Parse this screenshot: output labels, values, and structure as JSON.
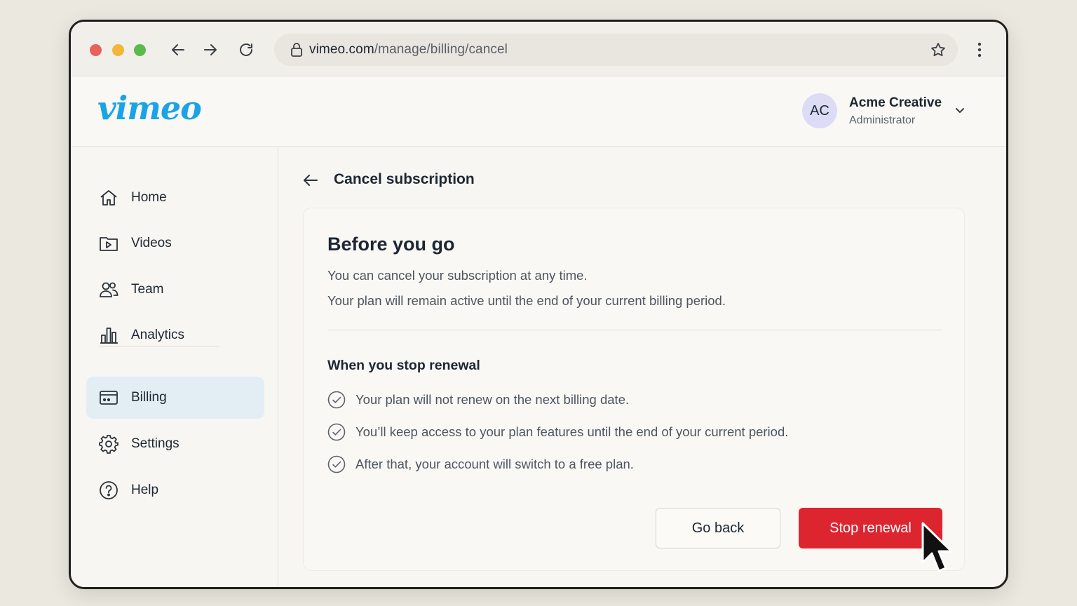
{
  "browser": {
    "url_host": "vimeo.com",
    "url_path": "/manage/billing/cancel"
  },
  "header": {
    "logo": "vimeo",
    "account": {
      "initials": "AC",
      "name": "Acme Creative",
      "role": "Administrator"
    }
  },
  "sidebar": {
    "items": [
      {
        "label": "Home",
        "icon": "home-icon"
      },
      {
        "label": "Videos",
        "icon": "video-icon"
      },
      {
        "label": "Team",
        "icon": "team-icon"
      },
      {
        "label": "Analytics",
        "icon": "analytics-icon"
      },
      {
        "label": "Billing",
        "icon": "billing-icon",
        "active": true
      },
      {
        "label": "Settings",
        "icon": "gear-icon"
      },
      {
        "label": "Help",
        "icon": "help-icon"
      }
    ]
  },
  "main": {
    "page_title": "Cancel subscription",
    "card": {
      "heading": "Before you go",
      "intro_1": "You can cancel your subscription at any time.",
      "intro_2": "Your plan will remain active until the end of your current billing period.",
      "subheading": "When you stop renewal",
      "points": [
        "Your plan will not renew on the next billing date.",
        "You’ll keep access to your plan features until the end of your current period.",
        "After that, your account will switch to a free plan."
      ],
      "secondary_button": "Go back",
      "primary_button": "Stop renewal"
    }
  },
  "colors": {
    "brand": "#1aa4e6",
    "danger": "#dd2530",
    "active_nav": "#e3eef4"
  }
}
